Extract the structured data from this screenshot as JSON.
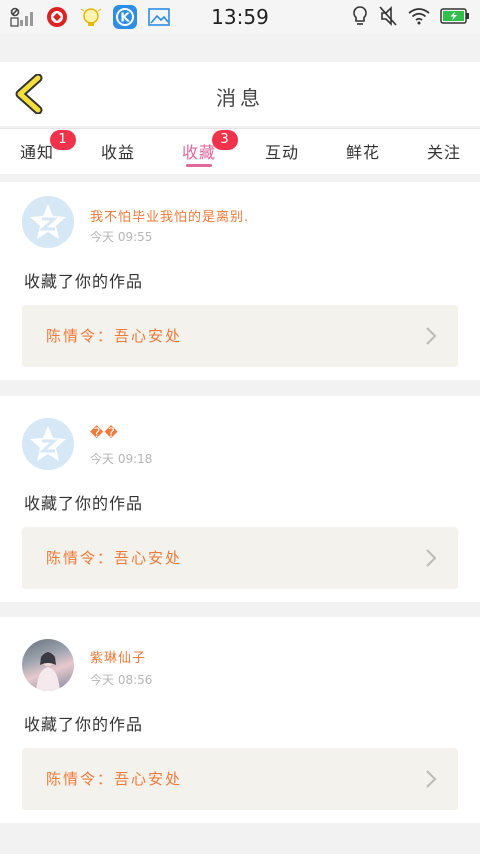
{
  "status_bar": {
    "time": "13:59",
    "icons": [
      "signal-off-icon",
      "app-red-icon",
      "lightbulb-app-icon",
      "k-app-icon",
      "gallery-icon",
      "bulb-outline-icon",
      "mute-icon",
      "wifi-icon",
      "battery-charging-icon"
    ]
  },
  "header": {
    "title": "消息",
    "back_icon": "chevron-left-icon"
  },
  "tabs": [
    {
      "label": "通知",
      "badge": "1"
    },
    {
      "label": "收益"
    },
    {
      "label": "收藏",
      "badge": "3",
      "active": true
    },
    {
      "label": "互动"
    },
    {
      "label": "鲜花"
    },
    {
      "label": "关注"
    }
  ],
  "colors": {
    "accent": "#e0669c",
    "badge": "#f0324a",
    "name": "#f07a3a"
  },
  "messages": [
    {
      "user": "我不怕毕业我怕的是离别.",
      "time": "今天 09:55",
      "action": "收藏了你的作品",
      "work": "陈情令：吾心安处"
    },
    {
      "user": "��",
      "time": "今天 09:18",
      "action": "收藏了你的作品",
      "work": "陈情令：吾心安处"
    },
    {
      "user": "紫琳仙子",
      "time": "今天 08:56",
      "action": "收藏了你的作品",
      "work": "陈情令：吾心安处"
    }
  ]
}
